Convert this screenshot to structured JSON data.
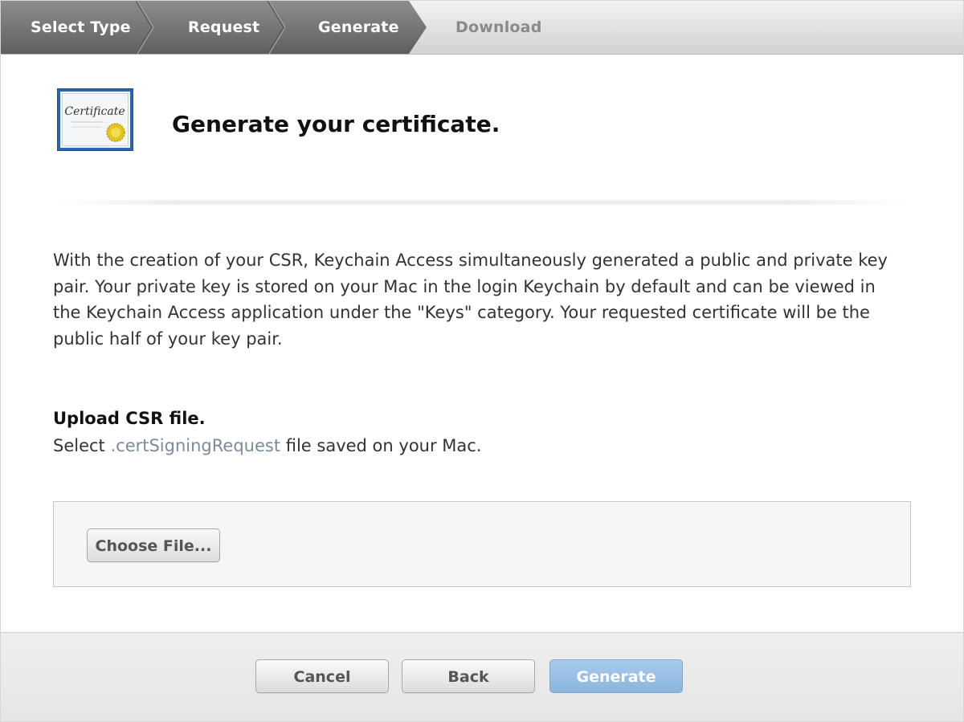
{
  "steps": [
    {
      "label": "Select Type",
      "state": "done"
    },
    {
      "label": "Request",
      "state": "done"
    },
    {
      "label": "Generate",
      "state": "current"
    },
    {
      "label": "Download",
      "state": "pending"
    }
  ],
  "header": {
    "icon_text": "Certificate",
    "title": "Generate your certificate."
  },
  "description": "With the creation of your CSR, Keychain Access simultaneously generated a public and private key pair. Your private key is stored on your Mac in the login Keychain by default and can be viewed in the Keychain Access application under the \"Keys\" category. Your requested certificate will be the public half of your key pair.",
  "upload": {
    "heading": "Upload CSR file.",
    "instruction_prefix": "Select ",
    "instruction_ext": ".certSigningRequest",
    "instruction_suffix": " file saved on your Mac.",
    "choose_label": "Choose File..."
  },
  "footer": {
    "cancel_label": "Cancel",
    "back_label": "Back",
    "generate_label": "Generate"
  },
  "colors": {
    "active_step_bg": "#6f6f6f",
    "pending_step_text": "#8a8a8a",
    "generate_button": "#9cc1e6",
    "link_ext_text": "#7a8b9c",
    "icon_border": "#1e5a9e",
    "seal": "#d9b800"
  }
}
